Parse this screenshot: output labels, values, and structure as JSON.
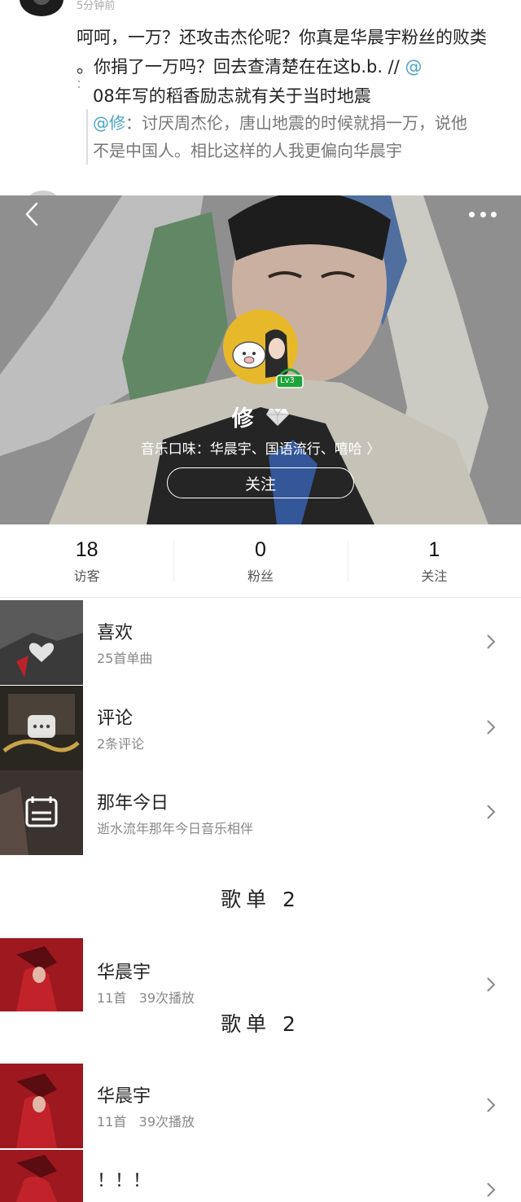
{
  "comment": {
    "time": "5分钟前",
    "text_1": "呵呵，一万？还攻击杰伦呢？你真是华晨宇粉丝的败类",
    "text_2": "。你捐了一万吗？回去查清楚在在这b.b. //",
    "at_mark": "@",
    "colon": ":",
    "text_3": "08年写的稻香励志就有关于当时地震",
    "quote_at": "@修",
    "quote_text_1": "：讨厌周杰伦，唐山地震的时候就捐一万，说他",
    "quote_text_2": "不是中国人。相比这样的人我更偏向华晨宇"
  },
  "profile": {
    "username": "修",
    "level": "Lv3",
    "music_taste": "音乐口味：华晨宇、国语流行、嘻哈 〉",
    "follow_label": "关注"
  },
  "stats": [
    {
      "value": "18",
      "label": "访客"
    },
    {
      "value": "0",
      "label": "粉丝"
    },
    {
      "value": "1",
      "label": "关注"
    }
  ],
  "menu": [
    {
      "title": "喜欢",
      "subtitle": "25首单曲"
    },
    {
      "title": "评论",
      "subtitle": "2条评论"
    },
    {
      "title": "那年今日",
      "subtitle": "逝水流年那年今日音乐相伴"
    }
  ],
  "playlist_sections": [
    {
      "heading": "歌单 2",
      "title": "华晨宇",
      "count": "11首",
      "plays": "39次播放"
    },
    {
      "heading": "歌单 2",
      "title": "华晨宇",
      "count": "11首",
      "plays": "39次播放"
    }
  ],
  "extra_playlist": {
    "title": "！！！"
  },
  "colors": {
    "link": "#4aa3c8",
    "level_badge": "#1fa33a",
    "avatar_bg": "#e7b92a"
  }
}
